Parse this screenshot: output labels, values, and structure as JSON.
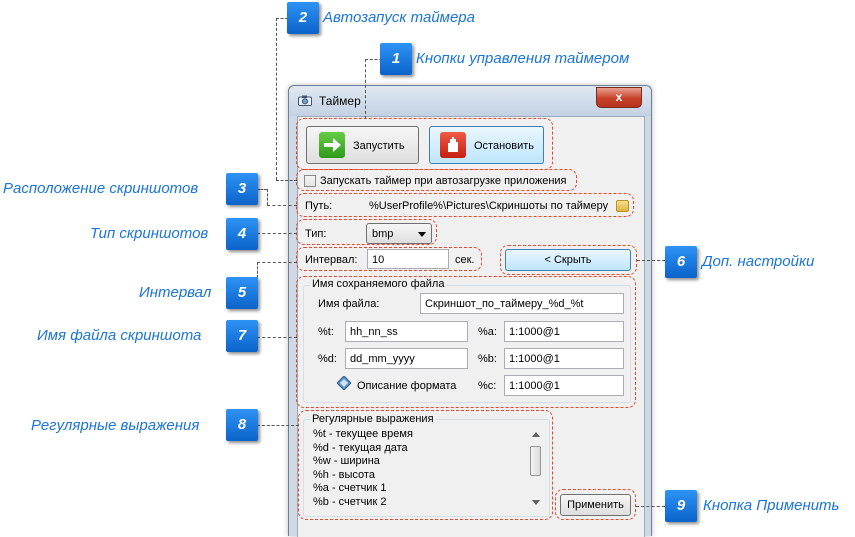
{
  "window": {
    "title": "Таймер",
    "close_glyph": "x"
  },
  "controls": {
    "start_label": "Запустить",
    "stop_label": "Остановить",
    "autostart_label": "Запускать таймер при автозагрузке приложения",
    "autostart_checked": false,
    "path_label": "Путь:",
    "path_value": "%UserProfile%\\Pictures\\Скриншоты по таймеру",
    "type_label": "Тип:",
    "type_value": "bmp",
    "interval_label": "Интервал:",
    "interval_value": "10",
    "interval_unit": "сек.",
    "hide_label": "< Скрыть",
    "apply_label": "Применить"
  },
  "filename_group": {
    "title": "Имя сохраняемого файла",
    "filename_label": "Имя файла:",
    "filename_value": "Скриншот_по_таймеру_%d_%t",
    "t_label": "%t:",
    "t_value": "hh_nn_ss",
    "d_label": "%d:",
    "d_value": "dd_mm_yyyy",
    "a_label": "%a:",
    "a_value": "1:1000@1",
    "b_label": "%b:",
    "b_value": "1:1000@1",
    "c_label": "%c:",
    "c_value": "1:1000@1",
    "format_desc_label": "Описание формата"
  },
  "regex_group": {
    "title": "Регулярные выражения",
    "items": [
      "%t - текущее время",
      "%d - текущая дата",
      "%w - ширина",
      "%h - высота",
      "%a - счетчик 1",
      "%b - счетчик 2"
    ]
  },
  "annotations": {
    "badges": [
      "1",
      "2",
      "3",
      "4",
      "5",
      "6",
      "7",
      "8",
      "9"
    ],
    "callouts": {
      "c1": "Кнопки управления таймером",
      "c2": "Автозапуск таймера",
      "c3": "Расположение скриншотов",
      "c4": "Тип скриншотов",
      "c5": "Интервал",
      "c6": "Доп. настройки",
      "c7": "Имя файла скриншота",
      "c8": "Регулярные выражения",
      "c9": "Кнопка Применить"
    }
  },
  "colors": {
    "annotation_red": "#e6452d",
    "badge_blue": "#1a7be6",
    "callout_text": "#1b74d6",
    "start_icon": "#3aa822",
    "stop_icon": "#d9301f"
  },
  "icons": [
    "camera-icon",
    "arrow-right-icon",
    "stop-hand-icon",
    "folder-icon",
    "info-diamond-icon",
    "chevron-down-icon"
  ]
}
